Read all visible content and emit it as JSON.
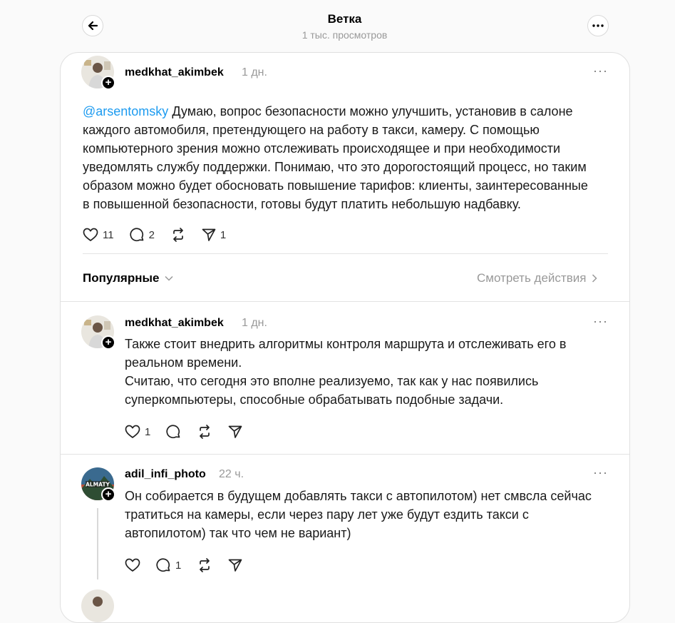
{
  "header": {
    "title": "Ветка",
    "subtitle": "1 тыс. просмотров"
  },
  "main_post": {
    "username": "medkhat_akimbek",
    "time": "1 дн.",
    "mention": "@arsentomsky",
    "lines": [
      " Думаю, вопрос безопасности можно улучшить, установив в салоне",
      "каждого автомобиля, претендующего на работу в такси, камеру. С помощью",
      "компьютерного зрения можно отслеживать происходящее и при необходимости",
      "уведомлять службу поддержки. Понимаю, что это дорогостоящий процесс, но таким",
      "образом можно будет обосновать повышение тарифов: клиенты, заинтересованные",
      "в повышенной безопасности, готовы будут платить небольшую надбавку."
    ],
    "likes": "11",
    "replies": "2",
    "shares": "1"
  },
  "sort_bar": {
    "sort_label": "Популярные",
    "see_actions": "Смотреть действия"
  },
  "replies": [
    {
      "username": "medkhat_akimbek",
      "time": "1 дн.",
      "lines": [
        "Также стоит внедрить алгоритмы контроля маршрута и отслеживать его в",
        "реальном времени.",
        "Считаю, что сегодня это вполне реализуемо, так как у нас появились",
        "суперкомпьютеры, способные обрабатывать подобные задачи."
      ],
      "likes": "1"
    },
    {
      "username": "adil_infi_photo",
      "time": "22 ч.",
      "lines": [
        "Он собирается в будущем добавлять такси с автопилотом) нет смвсла сейчас",
        "тратиться на камеры, если через пару лет уже будут ездить такси с",
        "автопилотом) так что чем не вариант)"
      ],
      "replies": "1"
    }
  ],
  "colors": {
    "mention": "#1d9bf0",
    "muted": "#999999",
    "background": "#fafafa"
  }
}
